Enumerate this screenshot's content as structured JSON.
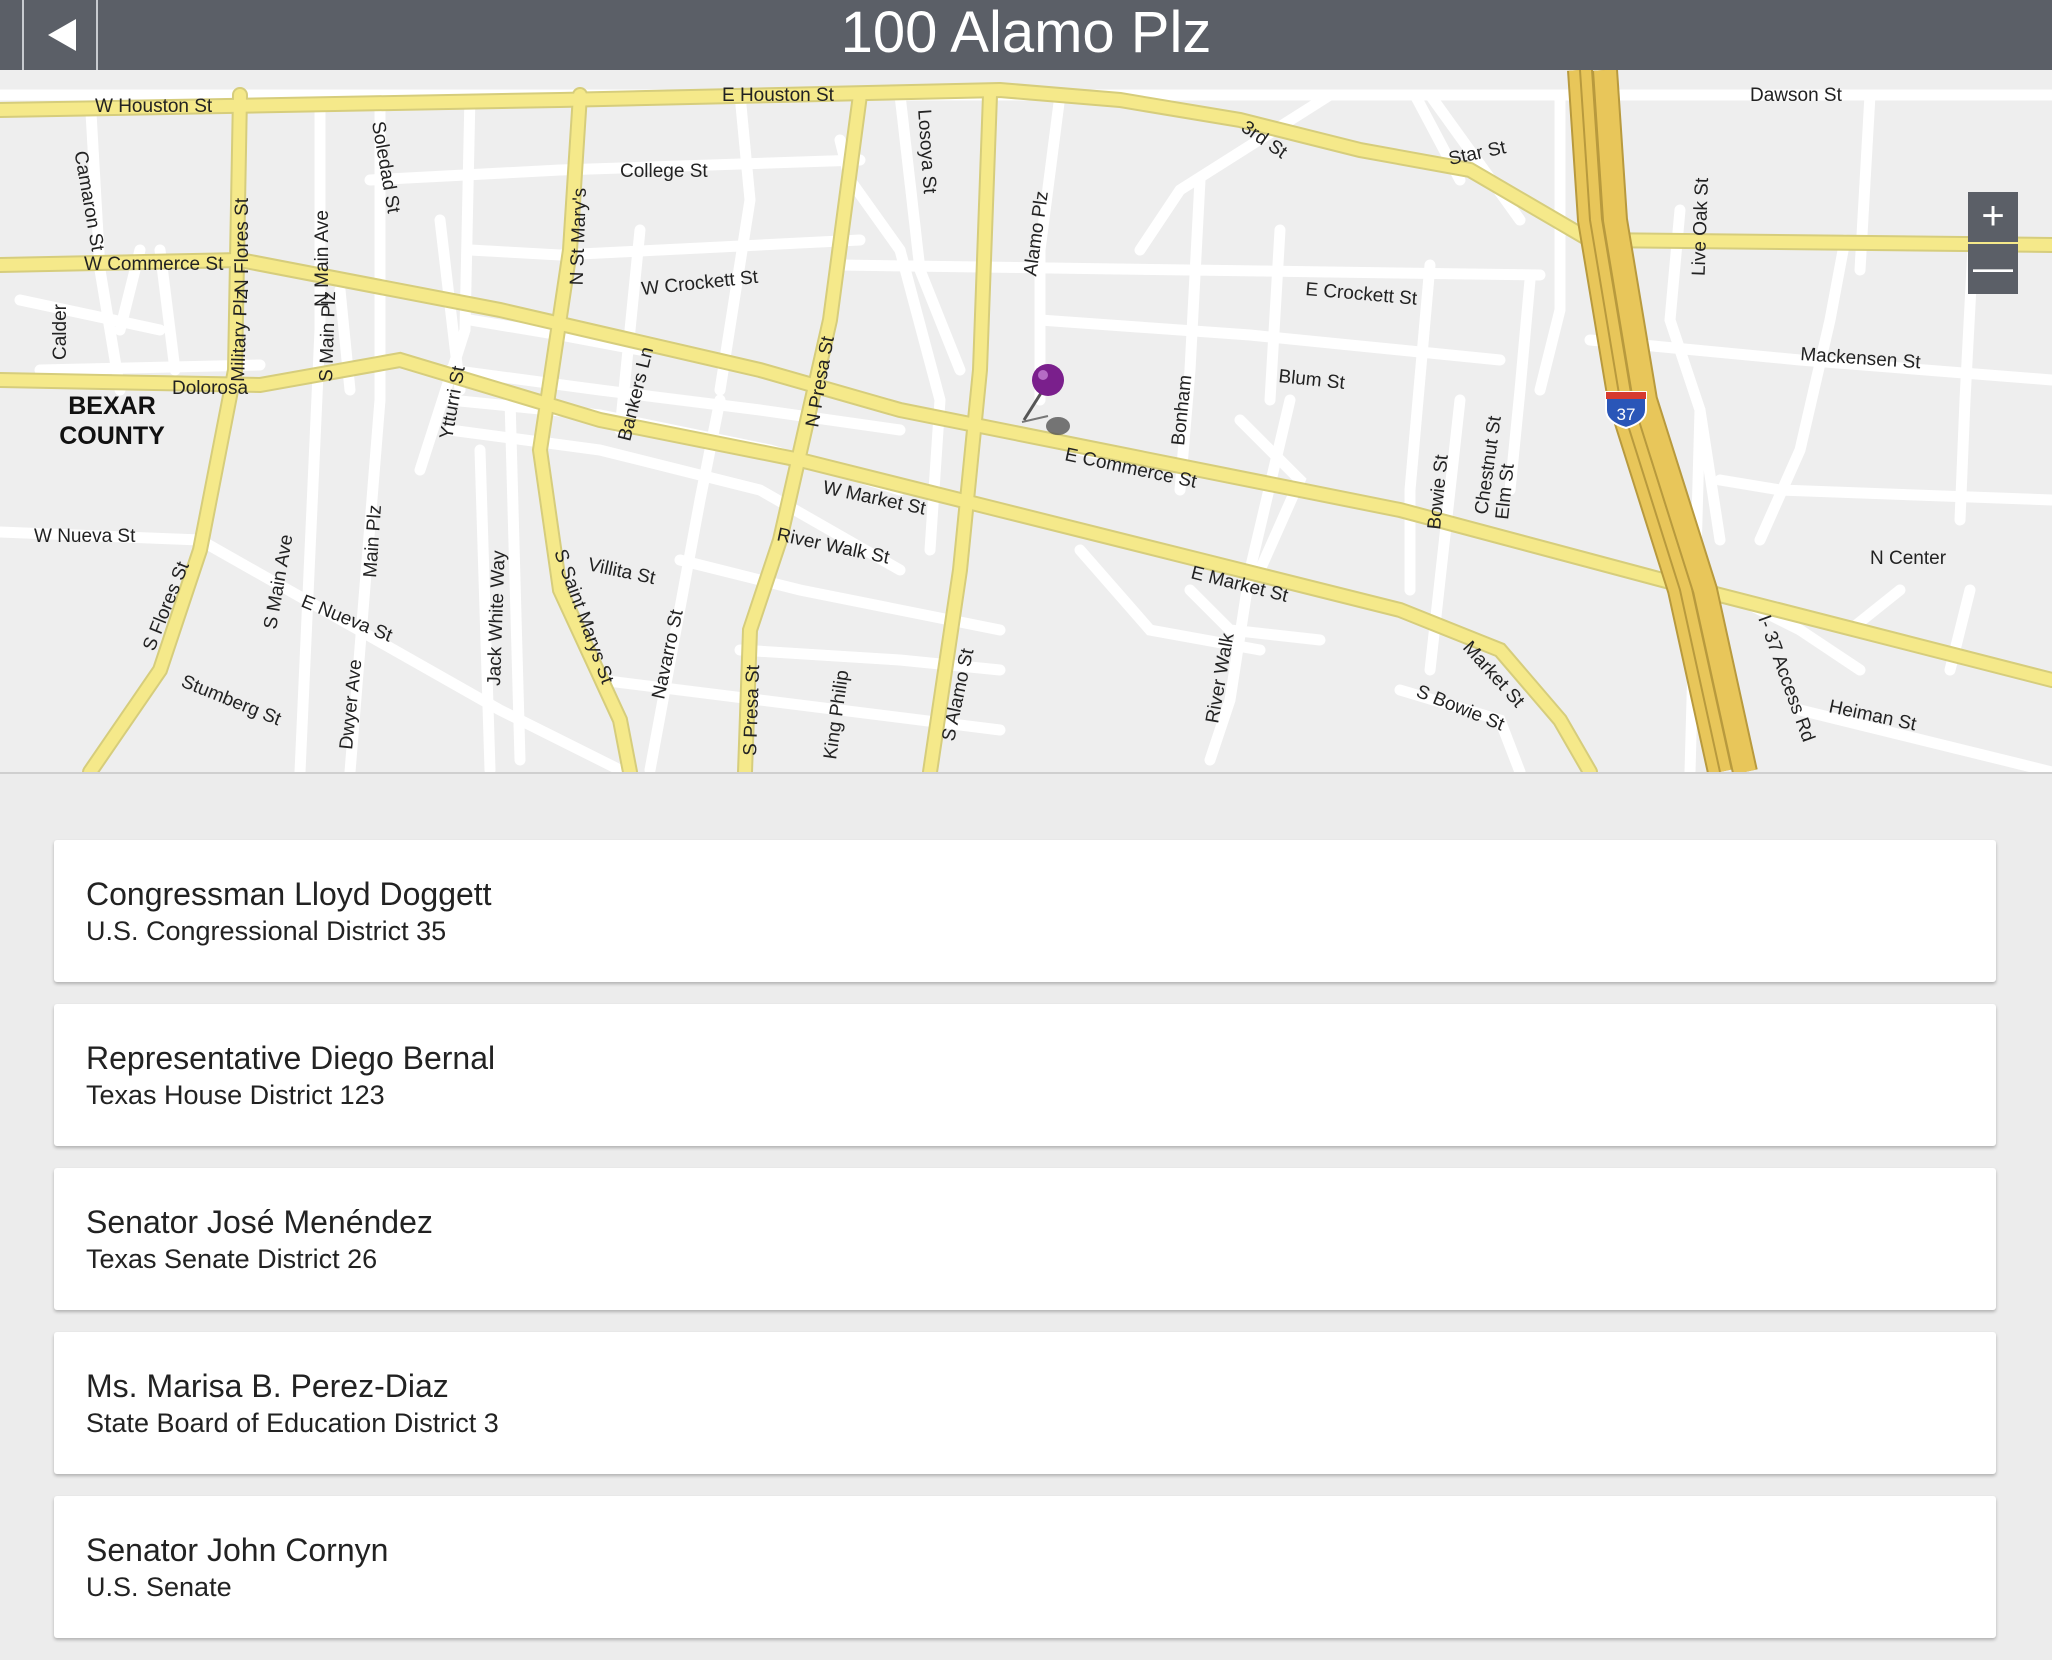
{
  "header": {
    "title": "100 Alamo Plz",
    "back_icon": "back-arrow-icon"
  },
  "map": {
    "county_line1": "BEXAR",
    "county_line2": "COUNTY",
    "zoom_in_label": "+",
    "zoom_out_label": "—",
    "highway_shield": "37",
    "streets": {
      "w_houston": "W Houston St",
      "e_houston": "E Houston St",
      "dawson": "Dawson St",
      "camaron": "Camaron St",
      "n_flores": "N Flores St",
      "n_main_ave": "N Main Ave",
      "soledad": "Soledad St",
      "n_st_marys": "N St Mary's",
      "college": "College St",
      "losoya": "Losoya St",
      "alamo_plz": "Alamo Plz",
      "third": "3rd St",
      "star": "Star St",
      "live_oak": "Live Oak St",
      "w_commerce": "W Commerce St",
      "w_crockett": "W Crockett St",
      "e_crockett": "E Crockett St",
      "calder": "Calder",
      "military_plz": "Military Plz",
      "s_main_plz": "S Main Plz",
      "dolorosa": "Dolorosa",
      "ytturri": "Ytturri St",
      "bankers_ln": "Bankers Ln",
      "n_presa": "N Presa St",
      "bonham": "Bonham",
      "blum": "Blum St",
      "mackensen": "Mackensen St",
      "chestnut": "Chestnut St",
      "e_commerce": "E Commerce St",
      "w_market": "W Market St",
      "bowie": "Bowie St",
      "elm": "Elm St",
      "w_nueva": "W Nueva St",
      "river_walk_st": "River Walk St",
      "villita": "Villita St",
      "n_center": "N Center",
      "s_flores": "S Flores St",
      "s_main_ave": "S Main Ave",
      "main_plz": "Main Plz",
      "e_nueva": "E Nueva St",
      "jack_white_way": "Jack White Way",
      "s_saint_marys": "S Saint Marys St",
      "navarro": "Navarro St",
      "e_market": "E Market St",
      "i37_access": "I- 37 Access Rd",
      "stumberg": "Stumberg St",
      "dwyer": "Dwyer Ave",
      "s_presa": "S Presa St",
      "king_philip": "King Philip",
      "s_alamo": "S Alamo St",
      "river_walk": "River Walk",
      "s_bowie": "S Bowie St",
      "market": "Market St",
      "heiman": "Heiman St"
    }
  },
  "officials": [
    {
      "name": "Congressman Lloyd Doggett",
      "office": "U.S. Congressional District 35"
    },
    {
      "name": "Representative Diego Bernal",
      "office": "Texas House District 123"
    },
    {
      "name": "Senator José Menéndez",
      "office": "Texas Senate District 26"
    },
    {
      "name": "Ms. Marisa B. Perez-Diaz",
      "office": "State Board of Education District 3"
    },
    {
      "name": "Senator John Cornyn",
      "office": "U.S. Senate"
    }
  ],
  "colors": {
    "header_bg": "#5b5f67",
    "major_road": "#f5e98a",
    "highway": "#e8c65a",
    "pin": "#7a1f8c"
  }
}
